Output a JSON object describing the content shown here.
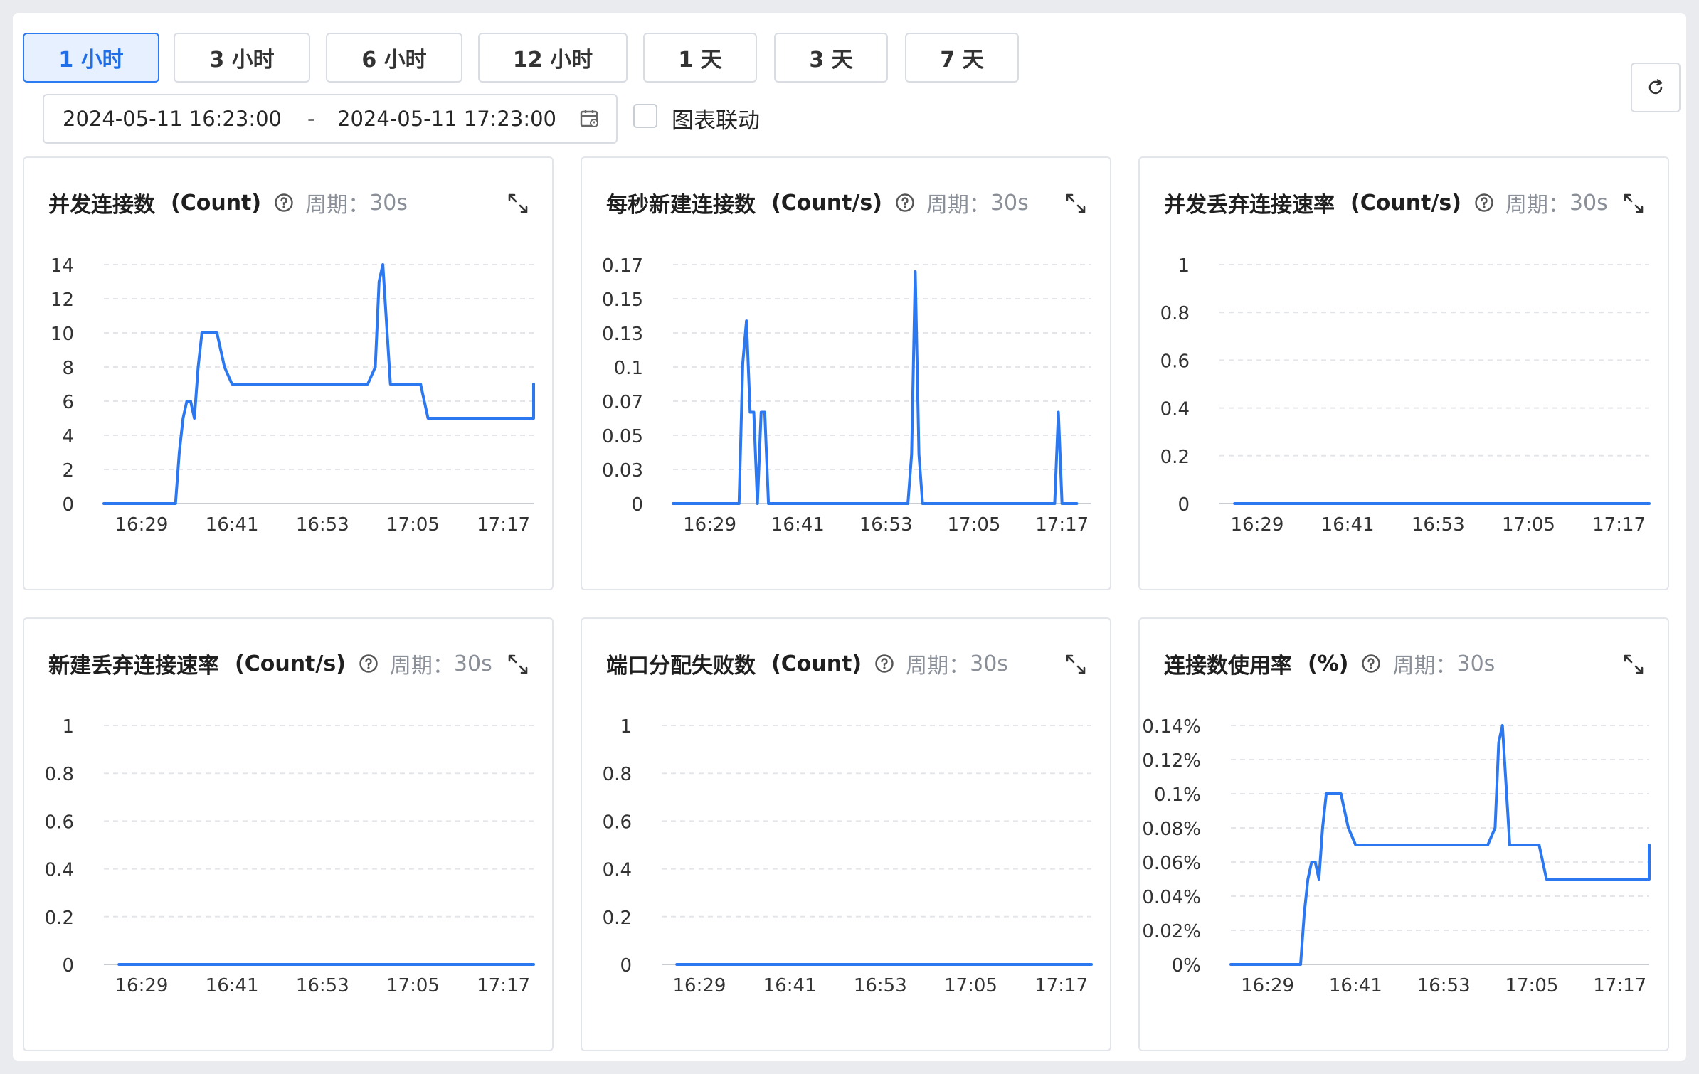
{
  "time_range_buttons": [
    "1 小时",
    "3 小时",
    "6 小时",
    "12 小时",
    "1 天",
    "3 天",
    "7 天"
  ],
  "date_range": {
    "start": "2024-05-11 16:23:00",
    "separator": "-",
    "end": "2024-05-11 17:23:00"
  },
  "linkage_label": "图表联动",
  "period_label": "周期：",
  "colors": {
    "line": "#2b78f0",
    "accent": "#1f6ee8"
  },
  "charts": [
    {
      "title": "并发连接数",
      "unit": "(Count)",
      "period": "30s",
      "chart_data": {
        "type": "line",
        "title": "并发连接数",
        "xlabel": "",
        "ylabel": "",
        "x_ticks": [
          "16:29",
          "16:41",
          "16:53",
          "17:05",
          "17:17"
        ],
        "y_ticks": [
          "0",
          "2",
          "4",
          "6",
          "8",
          "10",
          "12",
          "14"
        ],
        "ylim": [
          0,
          14
        ],
        "x_range_minutes": [
          -5,
          52
        ],
        "grid": true,
        "series": [
          {
            "x": [
              -5,
              4.5,
              5,
              5.5,
              6,
              6.5,
              7,
              7.5,
              8,
              9,
              10,
              11,
              12,
              14,
              30,
              31,
              31.5,
              32,
              33,
              37,
              38,
              52,
              53,
              57
            ],
            "values": [
              0,
              0,
              3,
              5,
              6,
              6,
              5,
              8,
              10,
              10,
              10,
              8,
              7,
              7,
              7,
              8,
              13,
              14,
              7,
              7,
              5,
              5,
              7,
              7
            ]
          }
        ]
      }
    },
    {
      "title": "每秒新建连接数",
      "unit": "(Count/s)",
      "period": "30s",
      "chart_data": {
        "type": "line",
        "title": "每秒新建连接数",
        "xlabel": "",
        "ylabel": "",
        "x_ticks": [
          "16:29",
          "16:41",
          "16:53",
          "17:05",
          "17:17"
        ],
        "y_ticks": [
          "0",
          "0.03",
          "0.05",
          "0.07",
          "0.1",
          "0.13",
          "0.15",
          "0.17"
        ],
        "ylim": [
          0,
          0.17
        ],
        "x_range_minutes": [
          -5,
          52
        ],
        "grid": true,
        "series": [
          {
            "x": [
              -5,
              4,
              4.5,
              5,
              5.5,
              6,
              6.5,
              7,
              7.5,
              8,
              8.5,
              27,
              27.5,
              28,
              28.5,
              29,
              47,
              47.5,
              48,
              50
            ],
            "values": [
              0,
              0,
              0.1,
              0.13,
              0.065,
              0.065,
              0,
              0.065,
              0.065,
              0,
              0,
              0,
              0.035,
              0.165,
              0.035,
              0,
              0,
              0.065,
              0,
              0
            ]
          }
        ]
      }
    },
    {
      "title": "并发丢弃连接速率",
      "unit": "(Count/s)",
      "period": "30s",
      "chart_data": {
        "type": "line",
        "title": "并发丢弃连接速率",
        "xlabel": "",
        "ylabel": "",
        "x_ticks": [
          "16:29",
          "16:41",
          "16:53",
          "17:05",
          "17:17"
        ],
        "y_ticks": [
          "0",
          "0.2",
          "0.4",
          "0.6",
          "0.8",
          "1"
        ],
        "ylim": [
          0,
          1
        ],
        "x_range_minutes": [
          -5,
          52
        ],
        "grid": true,
        "series": [
          {
            "x": [
              -3,
              55
            ],
            "values": [
              0,
              0
            ]
          }
        ]
      }
    },
    {
      "title": "新建丢弃连接速率",
      "unit": "(Count/s)",
      "period": "30s",
      "chart_data": {
        "type": "line",
        "title": "新建丢弃连接速率",
        "xlabel": "",
        "ylabel": "",
        "x_ticks": [
          "16:29",
          "16:41",
          "16:53",
          "17:05",
          "17:17"
        ],
        "y_ticks": [
          "0",
          "0.2",
          "0.4",
          "0.6",
          "0.8",
          "1"
        ],
        "ylim": [
          0,
          1
        ],
        "x_range_minutes": [
          -5,
          52
        ],
        "grid": true,
        "series": [
          {
            "x": [
              -3,
              55
            ],
            "values": [
              0,
              0
            ]
          }
        ]
      }
    },
    {
      "title": "端口分配失败数",
      "unit": "(Count)",
      "period": "30s",
      "chart_data": {
        "type": "line",
        "title": "端口分配失败数",
        "xlabel": "",
        "ylabel": "",
        "x_ticks": [
          "16:29",
          "16:41",
          "16:53",
          "17:05",
          "17:17"
        ],
        "y_ticks": [
          "0",
          "0.2",
          "0.4",
          "0.6",
          "0.8",
          "1"
        ],
        "ylim": [
          0,
          1
        ],
        "x_range_minutes": [
          -5,
          52
        ],
        "grid": true,
        "series": [
          {
            "x": [
              -3,
              55
            ],
            "values": [
              0,
              0
            ]
          }
        ]
      }
    },
    {
      "title": "连接数使用率",
      "unit": "(%)",
      "period": "30s",
      "chart_data": {
        "type": "line",
        "title": "连接数使用率",
        "xlabel": "",
        "ylabel": "",
        "x_ticks": [
          "16:29",
          "16:41",
          "16:53",
          "17:05",
          "17:17"
        ],
        "y_ticks": [
          "0%",
          "0.02%",
          "0.04%",
          "0.06%",
          "0.08%",
          "0.1%",
          "0.12%",
          "0.14%"
        ],
        "ylim": [
          0,
          0.14
        ],
        "x_range_minutes": [
          -5,
          52
        ],
        "grid": true,
        "series": [
          {
            "x": [
              -5,
              4.5,
              5,
              5.5,
              6,
              6.5,
              7,
              7.5,
              8,
              9,
              10,
              11,
              12,
              14,
              30,
              31,
              31.5,
              32,
              33,
              37,
              38,
              52,
              53,
              57
            ],
            "values": [
              0,
              0,
              0.03,
              0.05,
              0.06,
              0.06,
              0.05,
              0.08,
              0.1,
              0.1,
              0.1,
              0.08,
              0.07,
              0.07,
              0.07,
              0.08,
              0.13,
              0.14,
              0.07,
              0.07,
              0.05,
              0.05,
              0.07,
              0.07
            ]
          }
        ]
      }
    }
  ]
}
